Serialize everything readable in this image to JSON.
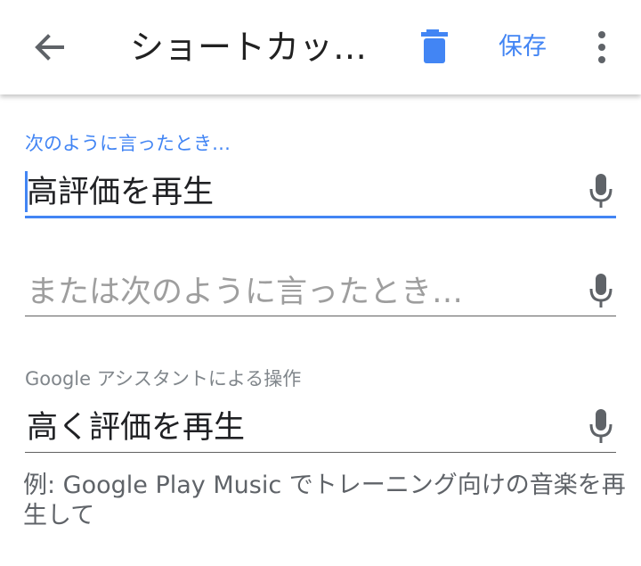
{
  "appbar": {
    "back_icon": "arrow-back-icon",
    "title": "ショートカッ…",
    "delete_icon": "trash-icon",
    "save_label": "保存",
    "more_icon": "more-vertical-icon",
    "accent_color": "#4285f4"
  },
  "form": {
    "phrase_label": "次のように言ったとき…",
    "phrase_value": "高評価を再生",
    "alt_phrase_placeholder": "または次のように言ったとき…",
    "action_label": "Google アシスタントによる操作",
    "action_value": "高く評価を再生",
    "mic_icon": "microphone-icon",
    "example_text": "例: Google Play Music でトレーニング向けの音楽を再生して"
  }
}
